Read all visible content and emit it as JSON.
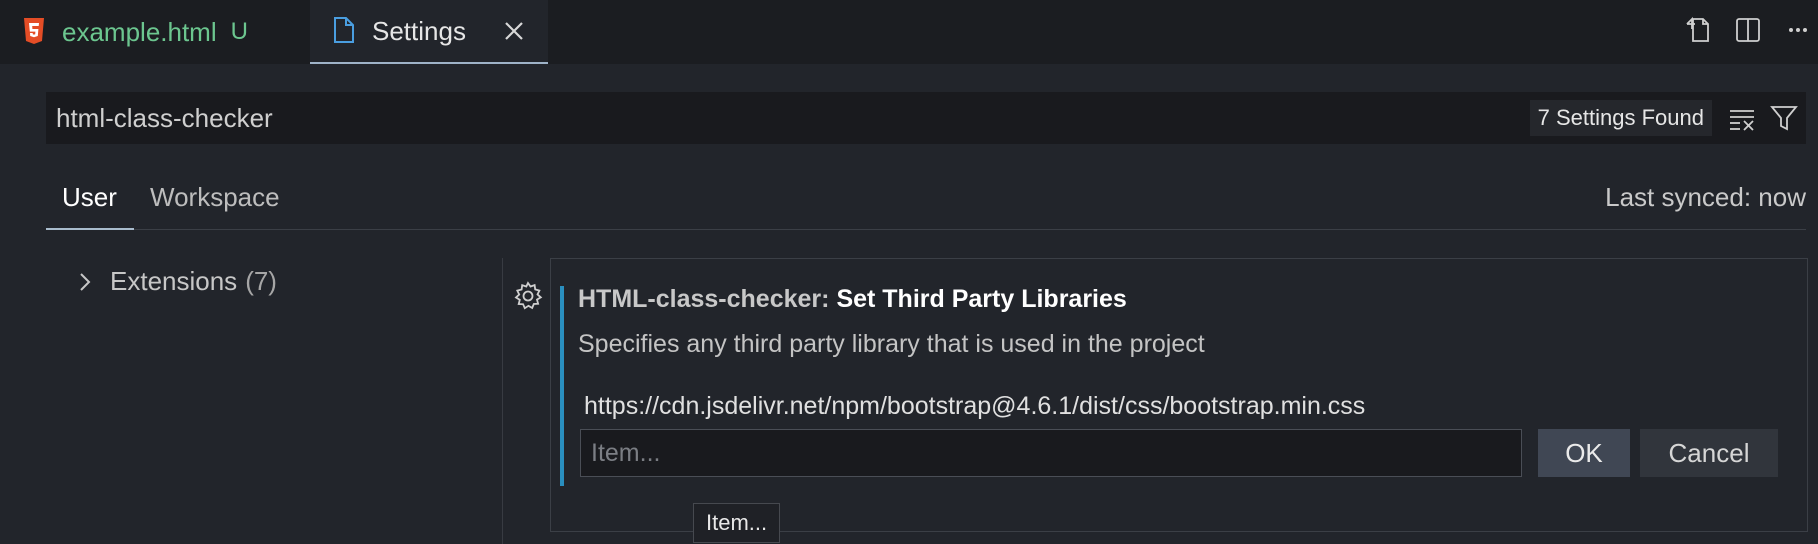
{
  "tabs": [
    {
      "label": "example.html",
      "badge": "U",
      "icon": "html5-icon"
    },
    {
      "label": "Settings",
      "icon": "file-icon"
    }
  ],
  "titlebar_actions": [
    "open-settings-json-icon",
    "split-editor-icon",
    "more-actions-icon"
  ],
  "search": {
    "value": "html-class-checker",
    "results_count": "7 Settings Found"
  },
  "scopes": {
    "user": "User",
    "workspace": "Workspace",
    "last_synced": "Last synced: now"
  },
  "toc": {
    "items": [
      {
        "label": "Extensions",
        "count": "(7)"
      }
    ]
  },
  "setting": {
    "category": "HTML-class-checker: ",
    "name": "Set Third Party Libraries",
    "description": "Specifies any third party library that is used in the project",
    "items": [
      "https://cdn.jsdelivr.net/npm/bootstrap@4.6.1/dist/css/bootstrap.min.css"
    ],
    "input_placeholder": "Item...",
    "ok_label": "OK",
    "cancel_label": "Cancel",
    "tooltip": "Item..."
  },
  "colors": {
    "accent": "#2a8fbf",
    "untracked": "#6cc68f",
    "html5": "#e44d26",
    "file_icon": "#4a9ee0"
  }
}
